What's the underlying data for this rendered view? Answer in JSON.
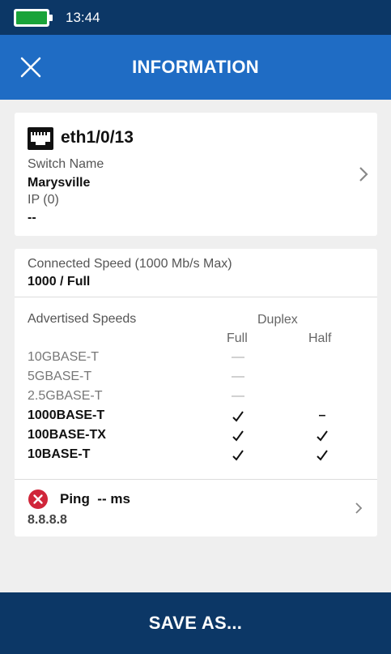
{
  "status_bar": {
    "time": "13:44",
    "battery_color": "#1aa33a"
  },
  "header": {
    "title": "INFORMATION",
    "close_icon": "close-icon",
    "color": "#1f6cc4"
  },
  "port_card": {
    "port_name": "eth1/0/13",
    "switch_name_label": "Switch Name",
    "switch_name_value": "Marysville",
    "ip_label": "IP (0)",
    "ip_value": "--"
  },
  "speed_card": {
    "connected_speed_label": "Connected Speed (1000 Mb/s Max)",
    "connected_speed_value": "1000 / Full",
    "advertised_label": "Advertised Speeds",
    "duplex_label": "Duplex",
    "full_label": "Full",
    "half_label": "Half",
    "speeds": [
      {
        "name": "10GBASE-T",
        "full": "—",
        "half": ""
      },
      {
        "name": "5GBASE-T",
        "full": "—",
        "half": ""
      },
      {
        "name": "2.5GBASE-T",
        "full": "—",
        "half": ""
      },
      {
        "name": "1000BASE-T",
        "full": "✓",
        "half": "–"
      },
      {
        "name": "100BASE-TX",
        "full": "✓",
        "half": "✓"
      },
      {
        "name": "10BASE-T",
        "full": "✓",
        "half": "✓"
      }
    ]
  },
  "ping": {
    "label": "Ping  -- ms",
    "target": "8.8.8.8",
    "status_color": "#d0263a"
  },
  "footer": {
    "save_label": "SAVE AS...",
    "color": "#0c3766"
  }
}
